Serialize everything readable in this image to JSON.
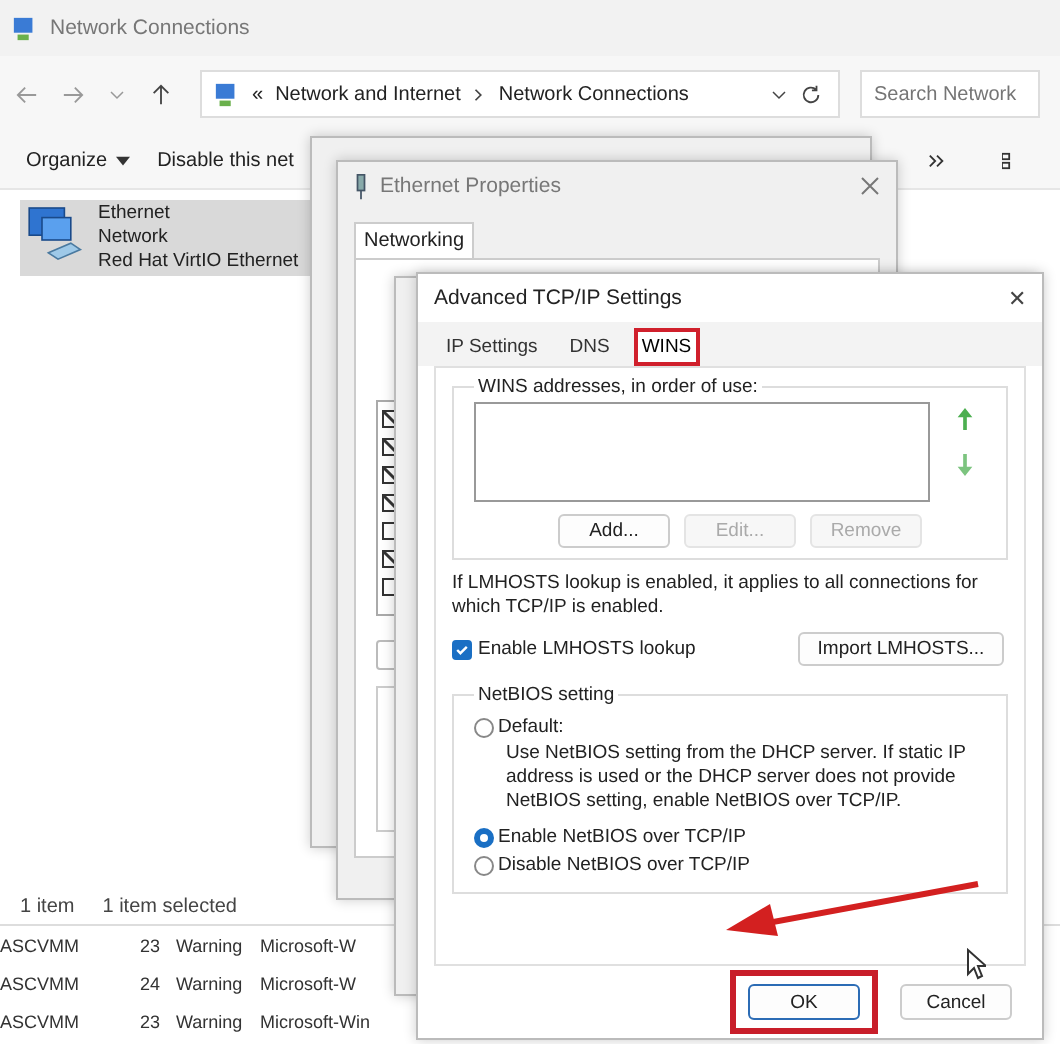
{
  "explorer": {
    "title": "Network Connections",
    "address": [
      "Network and Internet",
      "Network Connections"
    ],
    "address_prefix": "«",
    "search": {
      "placeholder": "Search Network"
    },
    "commands": [
      {
        "label": "Organize",
        "menu": true
      },
      {
        "label": "Disable this net",
        "menu": false
      }
    ],
    "connection": {
      "name": "Ethernet",
      "type": "Network",
      "adapter": "Red Hat VirtIO Ethernet",
      "selected": true
    },
    "status_bar": [
      "1 item",
      "1 item selected"
    ]
  },
  "event_rows": [
    {
      "computer": "ASCVMM",
      "id": "23",
      "level": "Warning",
      "source": "Microsoft-W"
    },
    {
      "computer": "ASCVMM",
      "id": "24",
      "level": "Warning",
      "source": "Microsoft-W"
    },
    {
      "computer": "ASCVMM",
      "id": "23",
      "level": "Warning",
      "source": "Microsoft-Win"
    }
  ],
  "properties_window": {
    "title": "Ethernet Properties",
    "tabs": [
      {
        "label": "Networking",
        "selected": true
      }
    ],
    "components": [
      {
        "checked": true
      },
      {
        "checked": true
      },
      {
        "checked": true
      },
      {
        "checked": true
      },
      {
        "checked": false
      },
      {
        "checked": true
      },
      {
        "checked": false
      }
    ]
  },
  "advanced": {
    "title": "Advanced TCP/IP Settings",
    "close": "✕",
    "tabs": [
      {
        "label": "IP Settings",
        "selected": false,
        "highlighted": false
      },
      {
        "label": "DNS",
        "selected": false,
        "highlighted": false
      },
      {
        "label": "WINS",
        "selected": true,
        "highlighted": true
      }
    ],
    "wins_group": "WINS addresses, in order of use:",
    "buttons": [
      {
        "label": "Add...",
        "disabled": false
      },
      {
        "label": "Edit...",
        "disabled": true
      },
      {
        "label": "Remove",
        "disabled": true
      }
    ],
    "note": "If LMHOSTS lookup is enabled, it applies to all connections for which TCP/IP is enabled.",
    "lmhosts": {
      "label": "Enable LMHOSTS lookup",
      "checked": true
    },
    "import_button": "Import LMHOSTS...",
    "netbios": {
      "title": "NetBIOS setting",
      "options": [
        {
          "label": "Default:",
          "selected": false,
          "description": "Use NetBIOS setting from the DHCP server. If static IP address is used or the DHCP server does not provide NetBIOS setting, enable NetBIOS over TCP/IP."
        },
        {
          "label": "Enable NetBIOS over TCP/IP",
          "selected": true
        },
        {
          "label": "Disable NetBIOS over TCP/IP",
          "selected": false
        }
      ]
    },
    "footer": [
      {
        "label": "OK",
        "highlighted": true
      },
      {
        "label": "Cancel",
        "highlighted": false
      }
    ]
  }
}
